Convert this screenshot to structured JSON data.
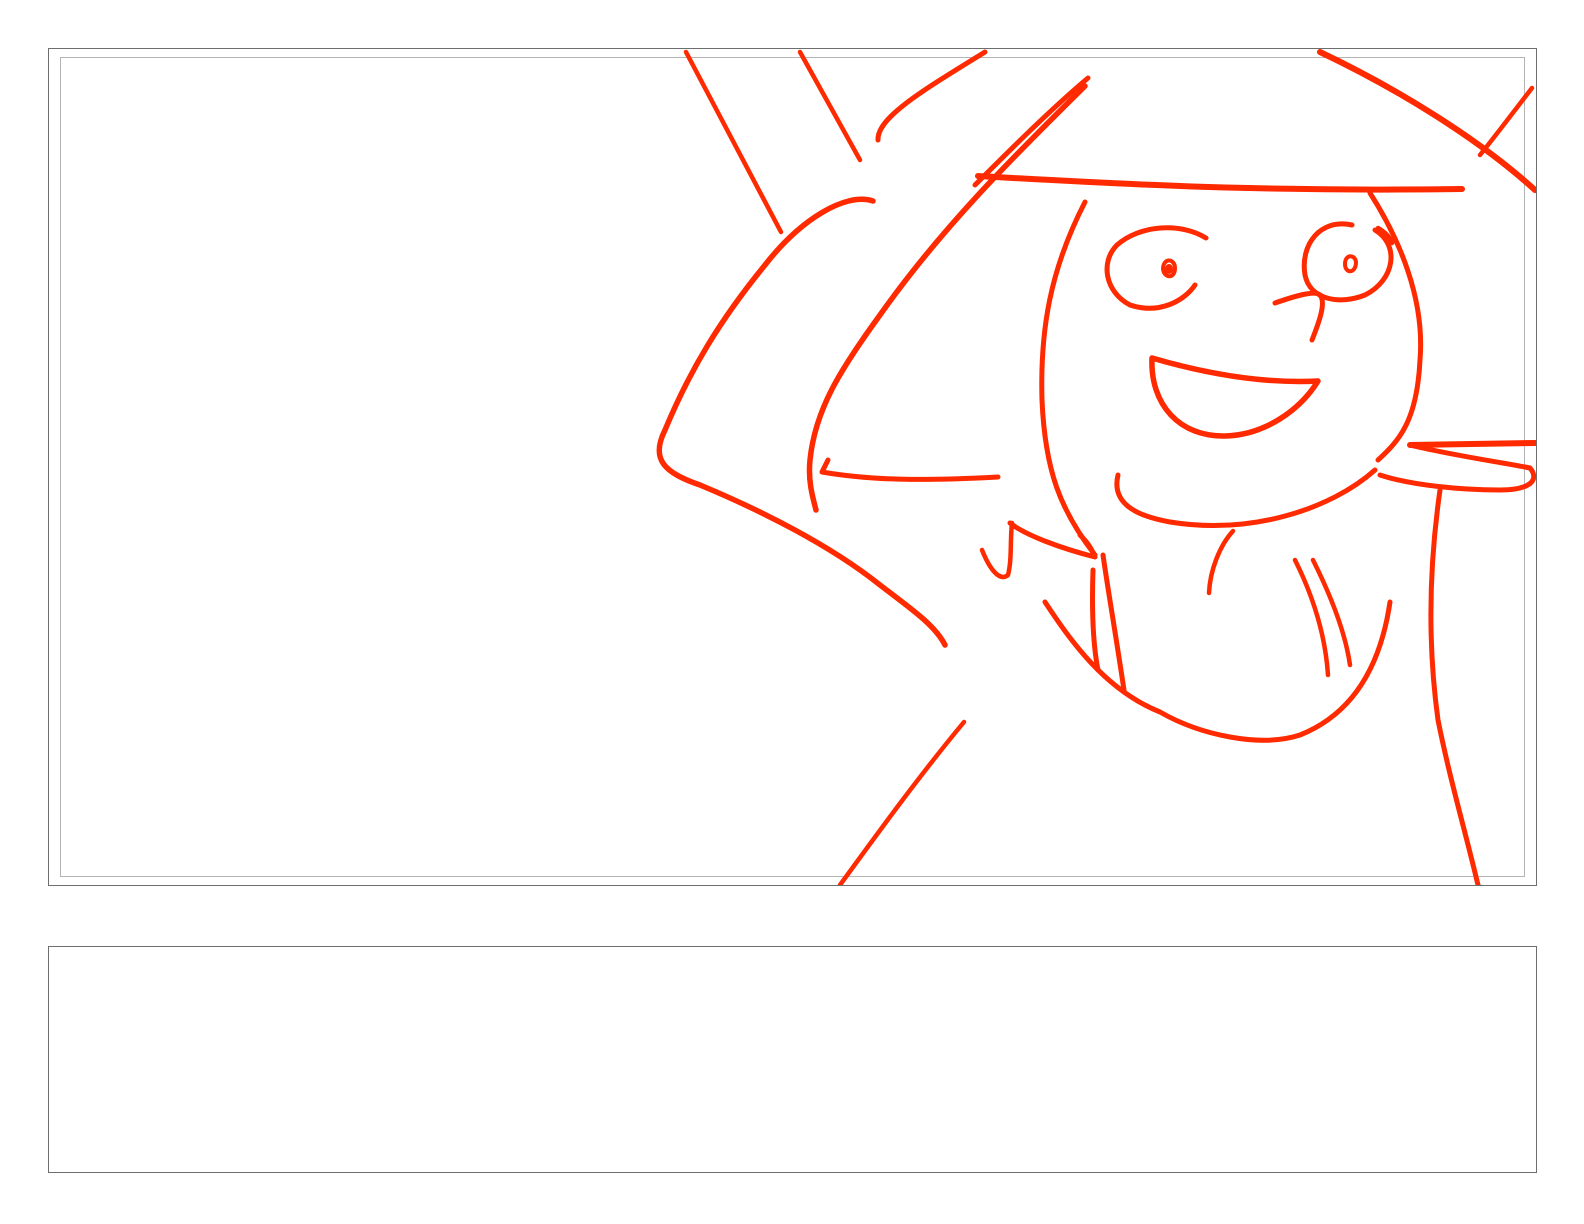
{
  "storyboard": {
    "panel": {
      "drawing": {
        "subject": "girl-in-wide-brim-hat-waving-sketch-icon",
        "stroke_color": "#ff2a00"
      }
    },
    "notes": {
      "text": ""
    }
  }
}
